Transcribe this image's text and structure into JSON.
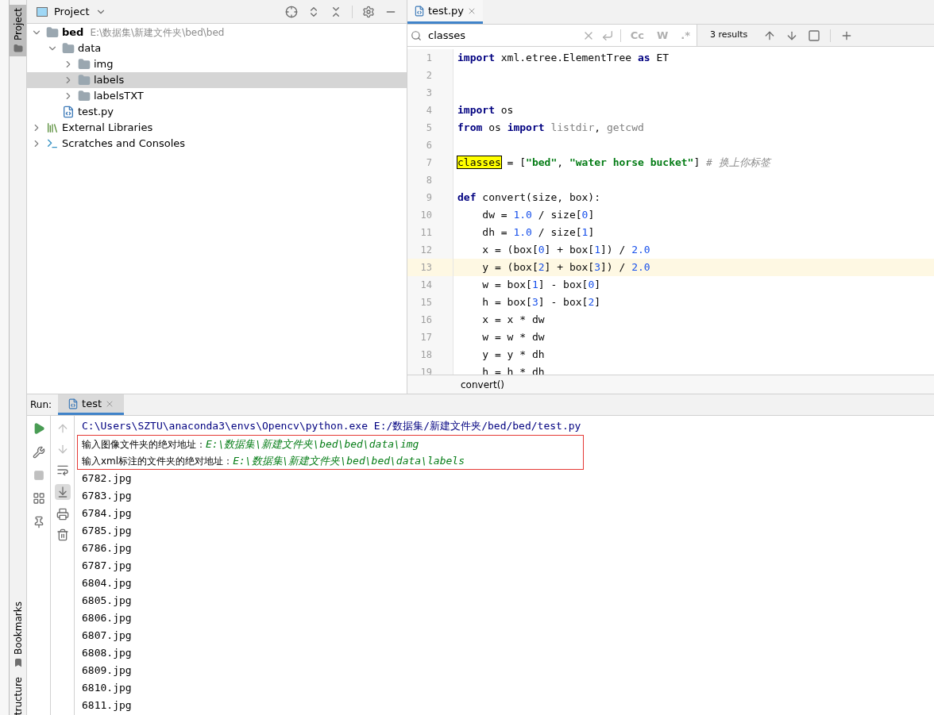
{
  "side_tabs_top": [
    {
      "label": "Project",
      "selected": true
    }
  ],
  "side_tabs_bottom": [
    {
      "label": "Bookmarks"
    },
    {
      "label": "tructure"
    }
  ],
  "project_panel": {
    "title": "Project",
    "tree": [
      {
        "name": "bed",
        "path": "E:\\数据集\\新建文件夹\\bed\\bed",
        "kind": "folder",
        "bold": true,
        "expanded": true,
        "selected": false,
        "children": [
          {
            "name": "data",
            "kind": "folder",
            "expanded": true,
            "selected": false,
            "children": [
              {
                "name": "img",
                "kind": "folder",
                "expanded": false,
                "selected": false
              },
              {
                "name": "labels",
                "kind": "folder",
                "expanded": false,
                "selected": true
              },
              {
                "name": "labelsTXT",
                "kind": "folder",
                "expanded": false,
                "selected": false
              }
            ]
          },
          {
            "name": "test.py",
            "kind": "python",
            "selected": false
          }
        ]
      },
      {
        "name": "External Libraries",
        "kind": "library",
        "expanded": false,
        "selected": false
      },
      {
        "name": "Scratches and Consoles",
        "kind": "scratches",
        "expanded": false,
        "selected": false
      }
    ]
  },
  "editor": {
    "tabs": [
      {
        "label": "test.py",
        "selected": true
      }
    ],
    "search": {
      "value": "classes",
      "options": [
        "Cc",
        "W",
        ".*"
      ],
      "results": "3 results"
    },
    "lines": [
      {
        "number": "1",
        "current": false,
        "tokens": [
          {
            "kind": "kw",
            "text": "import"
          },
          {
            "kind": "plain",
            "text": " xml.etree.ElementTree "
          },
          {
            "kind": "kw",
            "text": "as"
          },
          {
            "kind": "plain",
            "text": " ET"
          }
        ]
      },
      {
        "number": "2",
        "current": false
      },
      {
        "number": "3",
        "current": false
      },
      {
        "number": "4",
        "current": false,
        "tokens": [
          {
            "kind": "kw",
            "text": "import"
          },
          {
            "kind": "plain",
            "text": " os"
          }
        ]
      },
      {
        "number": "5",
        "current": false,
        "tokens": [
          {
            "kind": "kw",
            "text": "from"
          },
          {
            "kind": "plain",
            "text": " os "
          },
          {
            "kind": "kw",
            "text": "import"
          },
          {
            "kind": "dim",
            "text": " listdir"
          },
          {
            "kind": "plain",
            "text": ", "
          },
          {
            "kind": "dim",
            "text": "getcwd"
          }
        ]
      },
      {
        "number": "6",
        "current": false
      },
      {
        "number": "7",
        "current": false,
        "tokens": [
          {
            "kind": "match",
            "text": "classes"
          },
          {
            "kind": "plain",
            "text": " = ["
          },
          {
            "kind": "str",
            "text": "\"bed\""
          },
          {
            "kind": "plain",
            "text": ", "
          },
          {
            "kind": "str",
            "text": "\"water horse bucket\""
          },
          {
            "kind": "plain",
            "text": "] "
          },
          {
            "kind": "comment",
            "text": "# 换上你标签"
          }
        ]
      },
      {
        "number": "8",
        "current": false
      },
      {
        "number": "9",
        "current": false,
        "tokens": [
          {
            "kind": "kw",
            "text": "def"
          },
          {
            "kind": "plain",
            "text": " convert(size, box):"
          }
        ]
      },
      {
        "number": "10",
        "current": false,
        "tokens": [
          {
            "kind": "plain",
            "text": "    dw = "
          },
          {
            "kind": "num",
            "text": "1.0"
          },
          {
            "kind": "plain",
            "text": " / size["
          },
          {
            "kind": "num",
            "text": "0"
          },
          {
            "kind": "plain",
            "text": "]"
          }
        ]
      },
      {
        "number": "11",
        "current": false,
        "tokens": [
          {
            "kind": "plain",
            "text": "    dh = "
          },
          {
            "kind": "num",
            "text": "1.0"
          },
          {
            "kind": "plain",
            "text": " / size["
          },
          {
            "kind": "num",
            "text": "1"
          },
          {
            "kind": "plain",
            "text": "]"
          }
        ]
      },
      {
        "number": "12",
        "current": false,
        "tokens": [
          {
            "kind": "plain",
            "text": "    x = (box["
          },
          {
            "kind": "num",
            "text": "0"
          },
          {
            "kind": "plain",
            "text": "] + box["
          },
          {
            "kind": "num",
            "text": "1"
          },
          {
            "kind": "plain",
            "text": "]) / "
          },
          {
            "kind": "num",
            "text": "2.0"
          }
        ]
      },
      {
        "number": "13",
        "current": true,
        "tokens": [
          {
            "kind": "plain",
            "text": "    y = (box["
          },
          {
            "kind": "num",
            "text": "2"
          },
          {
            "kind": "plain",
            "text": "] + box["
          },
          {
            "kind": "num",
            "text": "3"
          },
          {
            "kind": "plain",
            "text": "]) / "
          },
          {
            "kind": "num",
            "text": "2.0"
          }
        ]
      },
      {
        "number": "14",
        "current": false,
        "tokens": [
          {
            "kind": "plain",
            "text": "    w = box["
          },
          {
            "kind": "num",
            "text": "1"
          },
          {
            "kind": "plain",
            "text": "] - box["
          },
          {
            "kind": "num",
            "text": "0"
          },
          {
            "kind": "plain",
            "text": "]"
          }
        ]
      },
      {
        "number": "15",
        "current": false,
        "tokens": [
          {
            "kind": "plain",
            "text": "    h = box["
          },
          {
            "kind": "num",
            "text": "3"
          },
          {
            "kind": "plain",
            "text": "] - box["
          },
          {
            "kind": "num",
            "text": "2"
          },
          {
            "kind": "plain",
            "text": "]"
          }
        ]
      },
      {
        "number": "16",
        "current": false,
        "tokens": [
          {
            "kind": "plain",
            "text": "    x = x * dw"
          }
        ]
      },
      {
        "number": "17",
        "current": false,
        "tokens": [
          {
            "kind": "plain",
            "text": "    w = w * dw"
          }
        ]
      },
      {
        "number": "18",
        "current": false,
        "tokens": [
          {
            "kind": "plain",
            "text": "    y = y * dh"
          }
        ]
      },
      {
        "number": "19",
        "current": false,
        "tokens": [
          {
            "kind": "plain",
            "text": "    h = h * dh"
          }
        ]
      }
    ],
    "breadcrumb": "convert()"
  },
  "run": {
    "label": "Run:",
    "tabs": [
      {
        "label": "test",
        "selected": true
      }
    ],
    "command": "C:\\Users\\SZTU\\anaconda3\\envs\\Opencv\\python.exe E:/数据集/新建文件夹/bed/bed/test.py",
    "inputs": [
      {
        "prompt": "输入图像文件夹的绝对地址：",
        "value": "E:\\数据集\\新建文件夹\\bed\\bed\\data\\img"
      },
      {
        "prompt": "输入xml标注的文件夹的绝对地址：",
        "value": "E:\\数据集\\新建文件夹\\bed\\bed\\data\\labels"
      }
    ],
    "output": [
      "6782.jpg",
      "6783.jpg",
      "6784.jpg",
      "6785.jpg",
      "6786.jpg",
      "6787.jpg",
      "6804.jpg",
      "6805.jpg",
      "6806.jpg",
      "6807.jpg",
      "6808.jpg",
      "6809.jpg",
      "6810.jpg",
      "6811.jpg"
    ]
  }
}
